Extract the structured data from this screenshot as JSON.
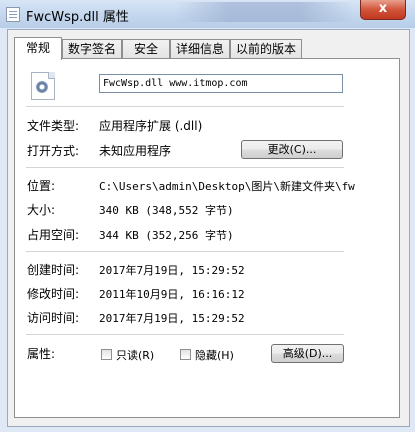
{
  "window": {
    "title": "FwcWsp.dll 属性",
    "close_label": "x"
  },
  "tabs": [
    {
      "label": "常规",
      "active": true
    },
    {
      "label": "数字签名",
      "active": false
    },
    {
      "label": "安全",
      "active": false
    },
    {
      "label": "详细信息",
      "active": false
    },
    {
      "label": "以前的版本",
      "active": false
    }
  ],
  "file": {
    "name": "FwcWsp.dll www.itmop.com"
  },
  "labels": {
    "file_type": "文件类型:",
    "opens_with": "打开方式:",
    "location": "位置:",
    "size": "大小:",
    "size_on_disk": "占用空间:",
    "created": "创建时间:",
    "modified": "修改时间:",
    "accessed": "访问时间:",
    "attributes": "属性:"
  },
  "values": {
    "file_type": "应用程序扩展 (.dll)",
    "opens_with": "未知应用程序",
    "location": "C:\\Users\\admin\\Desktop\\图片\\新建文件夹\\fw",
    "size": "340 KB (348,552 字节)",
    "size_on_disk": "344 KB (352,256 字节)",
    "created": "2017年7月19日, 15:29:52",
    "modified": "2011年10月9日, 16:16:12",
    "accessed": "2017年7月19日, 15:29:52"
  },
  "buttons": {
    "change": "更改(C)...",
    "advanced": "高级(D)..."
  },
  "attributes": {
    "readonly": {
      "label": "只读(R)",
      "checked": false
    },
    "hidden": {
      "label": "隐藏(H)",
      "checked": false
    }
  }
}
